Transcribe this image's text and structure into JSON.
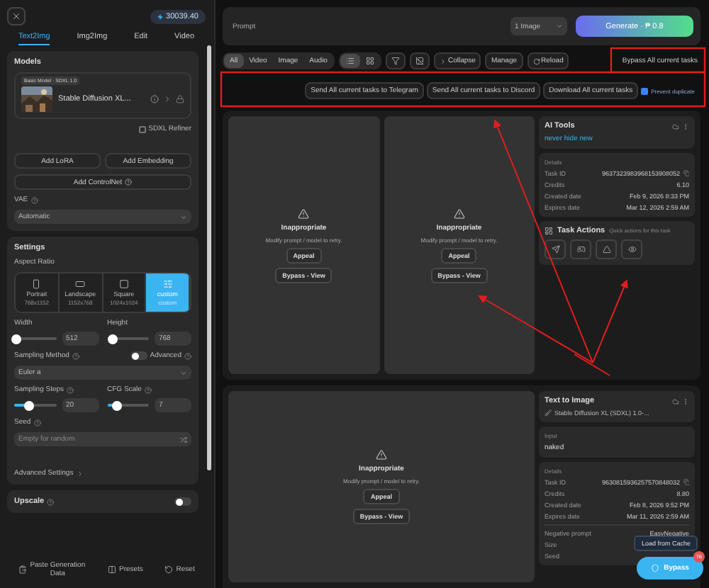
{
  "sidebar": {
    "credits": "30039.40",
    "tabs": [
      {
        "label": "Text2Img",
        "selected": true
      },
      {
        "label": "Img2Img",
        "selected": false
      },
      {
        "label": "Edit",
        "selected": false
      },
      {
        "label": "Video",
        "selected": false
      }
    ],
    "models": {
      "title": "Models",
      "model_badge": "Basic Model · SDXL 1.0",
      "model_name": "Stable Diffusion XL...",
      "refiner": {
        "label": "SDXL Refiner",
        "checked": false
      },
      "buttons": [
        "Add LoRA",
        "Add Embedding"
      ],
      "controlnet": "Add ControlNet",
      "vae_label": "VAE",
      "vae_value": "Automatic"
    },
    "settings": {
      "title": "Settings",
      "aspect_label": "Aspect Ratio",
      "ratios": [
        {
          "kind": "portrait",
          "label": "Portrait",
          "size": "768x1152",
          "selected": false
        },
        {
          "kind": "landscape",
          "label": "Landscape",
          "size": "1152x768",
          "selected": false
        },
        {
          "kind": "square",
          "label": "Square",
          "size": "1024x1024",
          "selected": false
        },
        {
          "kind": "custom",
          "label": "custom",
          "size": "custom",
          "selected": true
        }
      ],
      "size_sliders": [
        {
          "label": "Width",
          "value": "512",
          "level": 0.05
        },
        {
          "label": "Height",
          "value": "768",
          "level": 0.15
        }
      ],
      "sampling_method": "Sampling Method",
      "advanced": {
        "label": "Advanced",
        "on": false
      },
      "sampler": "Euler a",
      "step_sliders": [
        {
          "label": "Sampling Steps",
          "value": "20",
          "level": 0.35
        },
        {
          "label": "CFG Scale",
          "value": "7",
          "level": 0.25
        }
      ],
      "seed_label": "Seed",
      "seed_placeholder": "Empty for random",
      "advanced_settings": "Advanced Settings"
    },
    "upscale": {
      "label": "Upscale",
      "on": false
    },
    "footer": [
      "Paste Generation Data",
      "Presets",
      "Reset"
    ]
  },
  "prompt": {
    "placeholder": "Prompt",
    "count": "1 Image",
    "generate": "Generate · ₱ 0.8"
  },
  "filters": [
    {
      "label": "All",
      "selected": true
    },
    {
      "label": "Video",
      "selected": false
    },
    {
      "label": "Image",
      "selected": false
    },
    {
      "label": "Audio",
      "selected": false
    }
  ],
  "views": [
    {
      "kind": "list",
      "selected": true
    },
    {
      "kind": "grid",
      "selected": false
    }
  ],
  "toolbar": {
    "collapse": "Collapse",
    "manage": "Manage",
    "reload": "Reload",
    "bypass_all": "Bypass All current tasks"
  },
  "bulk": {
    "buttons": [
      "Send All current tasks to Telegram",
      "Send All current tasks to Discord",
      "Download All current tasks"
    ],
    "prevent": {
      "label": "Prevent duplicate",
      "checked": true
    }
  },
  "tasks": [
    {
      "images": [
        {
          "status": "Inappropriate",
          "hint": "Modify prompt / model to retry.",
          "appeal": "Appeal",
          "bypass": "Bypass - View"
        },
        {
          "status": "Inappropriate",
          "hint": "Modify prompt / model to retry.",
          "appeal": "Appeal",
          "bypass": "Bypass - View"
        }
      ],
      "title": "AI Tools",
      "link": "never hide new",
      "details_label": "Details",
      "details": [
        {
          "label": "Task ID",
          "value": "9637323983968153908052",
          "copy": true
        },
        {
          "label": "Credits",
          "value": "6.10"
        },
        {
          "label": "Created date",
          "value": "Feb 9, 2026 8:33 PM"
        },
        {
          "label": "Expires date",
          "value": "Mar 12, 2026 2:59 AM"
        }
      ],
      "actions": {
        "title": "Task Actions",
        "subtitle": "Quick actions for this task"
      }
    },
    {
      "images": [
        {
          "status": "Inappropriate",
          "hint": "Modify prompt / model to retry.",
          "appeal": "Appeal",
          "bypass": "Bypass - View"
        }
      ],
      "title": "Text to Image",
      "model": "Stable Diffusion XL (SDXL) 1.0-...",
      "input_label": "Input",
      "input": "naked",
      "details_label": "Details",
      "details": [
        {
          "label": "Task ID",
          "value": "9630815936257570848032",
          "copy": true
        },
        {
          "label": "Credits",
          "value": "8.80"
        },
        {
          "label": "Created date",
          "value": "Feb 8, 2026 9:52 PM"
        },
        {
          "label": "Expires date",
          "value": "Mar 11, 2026 2:59 AM"
        }
      ],
      "extra": [
        {
          "label": "Negative prompt",
          "value": "EasyNegative"
        },
        {
          "label": "Size"
        },
        {
          "label": "Seed"
        }
      ]
    }
  ],
  "floating": {
    "tooltip": "Load from Cache",
    "button": "Bypass",
    "badge": "76"
  }
}
